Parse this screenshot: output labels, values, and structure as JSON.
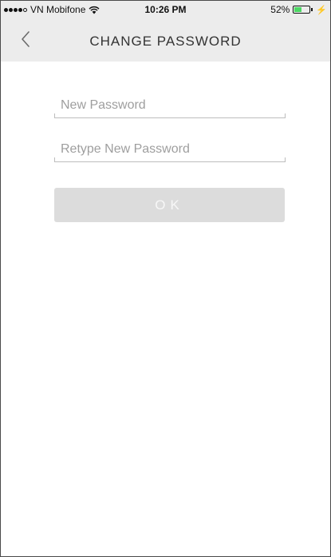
{
  "status_bar": {
    "carrier": "VN Mobifone",
    "time": "10:26 PM",
    "battery_percent": "52%",
    "battery_level": 0.52,
    "battery_color": "#4cd964",
    "signal_bars_filled": 4,
    "signal_bars_total": 5,
    "icons": [
      "signal-dots-icon",
      "wifi-icon",
      "battery-icon",
      "charging-bolt-icon"
    ]
  },
  "nav": {
    "title": "CHANGE PASSWORD",
    "back_icon": "chevron-left-icon"
  },
  "form": {
    "new_password": {
      "placeholder": "New Password",
      "value": ""
    },
    "retype_password": {
      "placeholder": "Retype New Password",
      "value": ""
    },
    "ok_label": "OK"
  },
  "colors": {
    "nav_background": "#ececec",
    "button_background": "#dcdcdc",
    "placeholder_text": "#9e9e9e"
  }
}
